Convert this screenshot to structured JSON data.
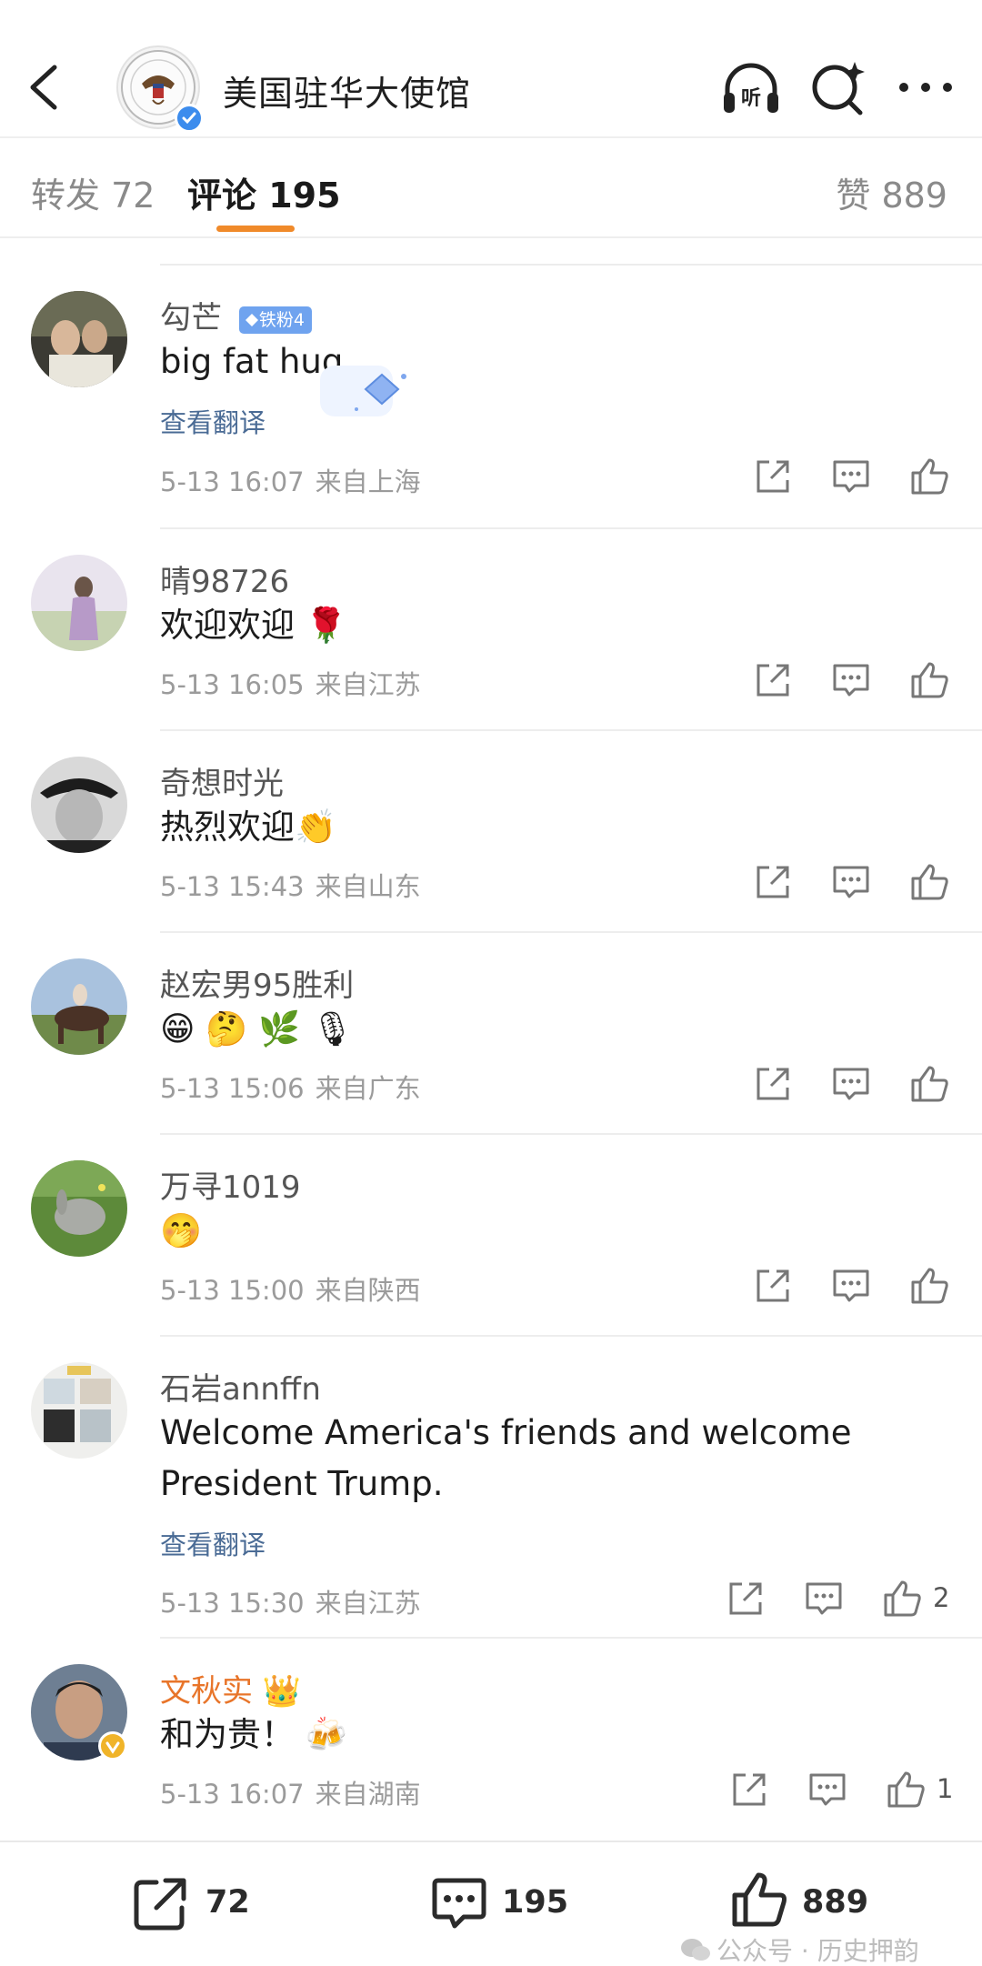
{
  "header": {
    "title": "美国驻华大使馆",
    "back_icon": "chevron-left-icon",
    "listen_label": "听",
    "accent_verified": "#3c8ced"
  },
  "tabs": {
    "repost": "转发 72",
    "comment": "评论 195",
    "like": "赞 889",
    "active_color": "#f08a2a"
  },
  "comments": [
    {
      "user": "勾芒",
      "badge": "铁粉4",
      "text": "big fat hug",
      "translate": "查看翻译",
      "time": "5-13 16:07",
      "location": "来自上海",
      "likes": ""
    },
    {
      "user": "晴98726",
      "text": "欢迎欢迎 🌹",
      "time": "5-13 16:05",
      "location": "来自江苏",
      "likes": ""
    },
    {
      "user": "奇想时光",
      "text": "热烈欢迎👏",
      "time": "5-13 15:43",
      "location": "来自山东",
      "likes": ""
    },
    {
      "user": "赵宏男95胜利",
      "text": "😁 🤔 🌿 🎙",
      "time": "5-13 15:06",
      "location": "来自广东",
      "likes": ""
    },
    {
      "user": "万寻1019",
      "text": "🤭",
      "time": "5-13 15:00",
      "location": "来自陕西",
      "likes": ""
    },
    {
      "user": "石岩annffn",
      "text_line1": "Welcome America's friends and welcome",
      "text_line2": "President Trump.",
      "translate": "查看翻译",
      "time": "5-13 15:30",
      "location": "来自江苏",
      "likes": "2"
    },
    {
      "user": "文秋实 👑",
      "text": "和为贵！ 🍻",
      "time": "5-13 16:07",
      "location": "来自湖南",
      "likes": "1"
    }
  ],
  "bottom_bar": {
    "repost_count": "72",
    "comment_count": "195",
    "like_count": "889",
    "watermark": "公众号 · 历史押韵"
  }
}
